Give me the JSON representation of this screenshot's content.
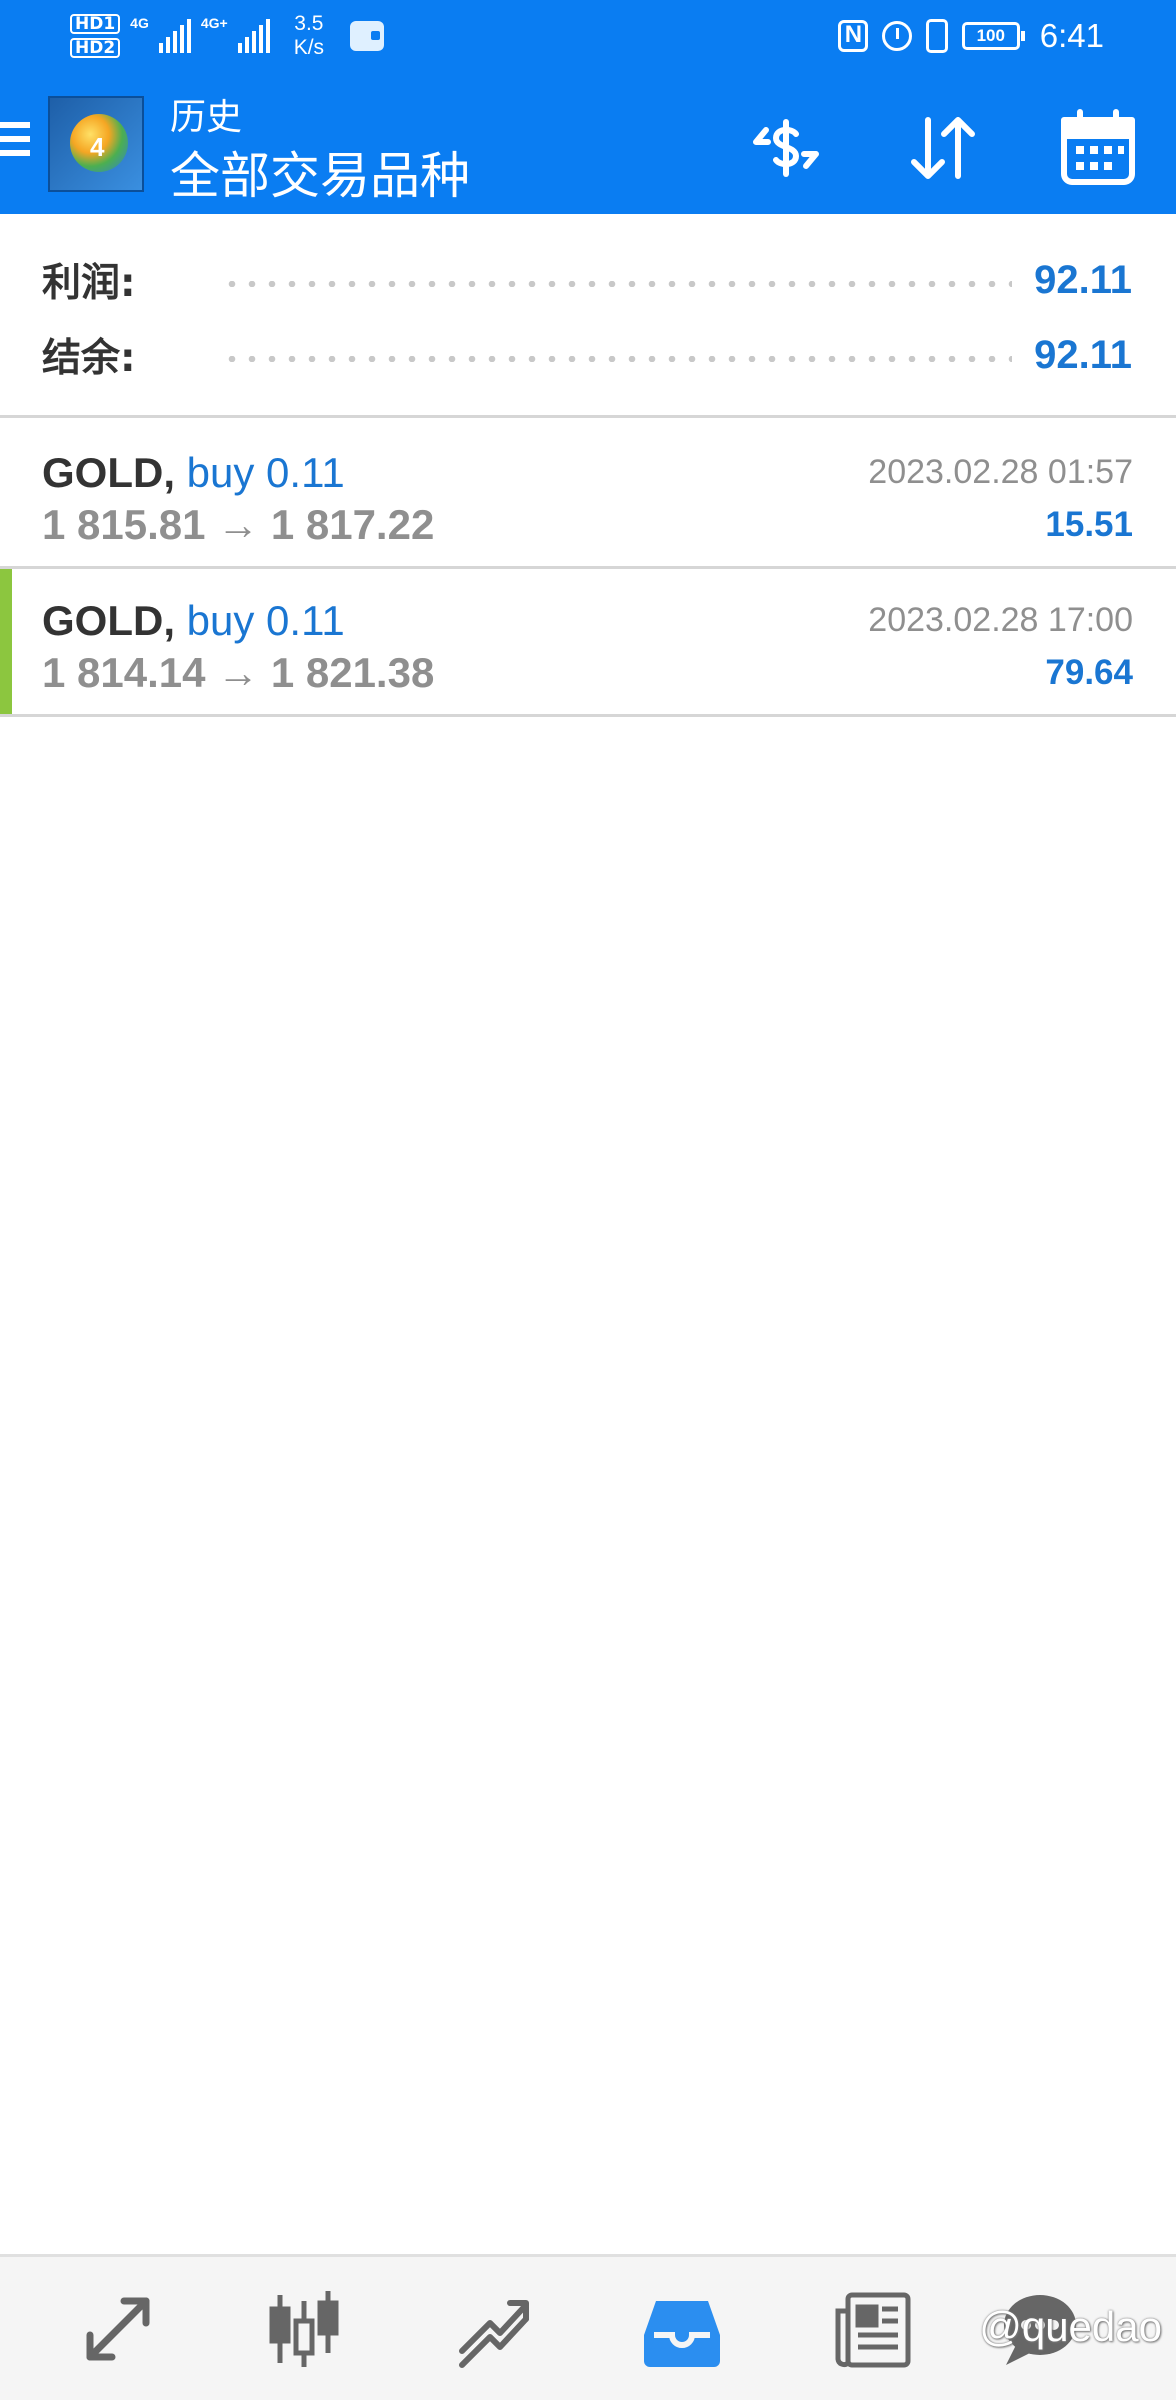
{
  "status_bar": {
    "hd1": "HD1",
    "hd2": "HD2",
    "net1": "4G",
    "net2": "4G+",
    "speed_value": "3.5",
    "speed_unit": "K/s",
    "battery": "100",
    "time": "6:41"
  },
  "app_bar": {
    "title": "历史",
    "subtitle": "全部交易品种",
    "icons": [
      "menu-icon",
      "metatrader-logo",
      "currency-exchange-icon",
      "sort-icon",
      "calendar-icon"
    ]
  },
  "summary": {
    "profit_label": "利润:",
    "profit_value": "92.11",
    "balance_label": "结余:",
    "balance_value": "92.11"
  },
  "deals": [
    {
      "symbol": "GOLD,",
      "trade": "buy 0.11",
      "prices": "1 815.81 → 1 817.22",
      "time": "2023.02.28 01:57",
      "profit": "15.51"
    },
    {
      "symbol": "GOLD,",
      "trade": "buy 0.11",
      "prices": "1 814.14 → 1 821.38",
      "time": "2023.02.28 17:00",
      "profit": "79.64"
    }
  ],
  "bottom_nav": {
    "items": [
      "quotes-icon",
      "chart-icon",
      "trade-icon",
      "history-icon",
      "news-icon",
      "chat-icon"
    ],
    "active": "history-icon",
    "watermark": "@quedao"
  },
  "colors": {
    "primary": "#0a7df2",
    "accent_text": "#1a76d2",
    "active_marker": "#8cc63f",
    "muted_text": "#8f8f8f"
  }
}
